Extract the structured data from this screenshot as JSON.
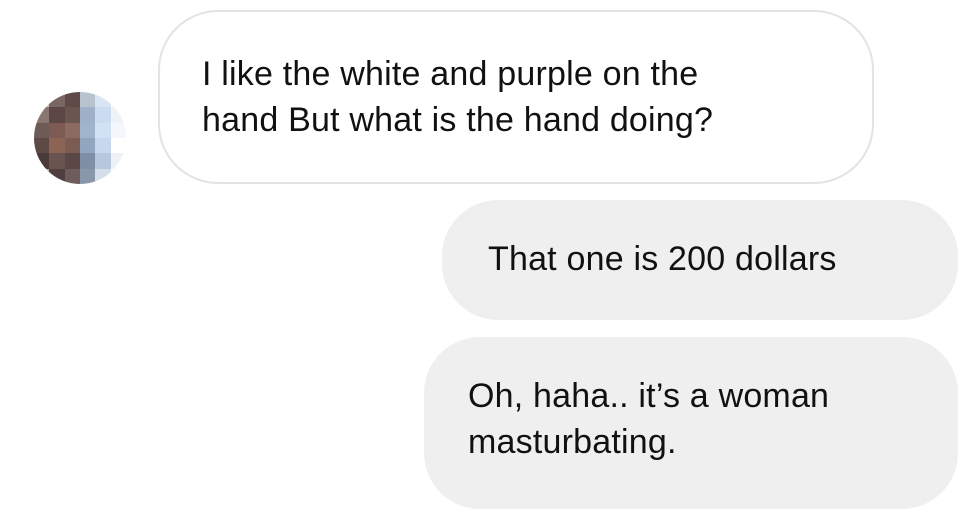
{
  "conversation": {
    "messages": [
      {
        "sender": "other",
        "lines": [
          "I like the white and purple on the",
          "hand But what is the hand doing?"
        ]
      },
      {
        "sender": "me",
        "lines": [
          "That one is 200 dollars"
        ]
      },
      {
        "sender": "me",
        "lines": [
          "Oh, haha.. it’s a woman",
          "masturbating."
        ]
      }
    ]
  },
  "colors": {
    "incoming_bubble_border": "#e3e3e3",
    "outgoing_bubble_bg": "#efefef",
    "text": "#111111"
  }
}
